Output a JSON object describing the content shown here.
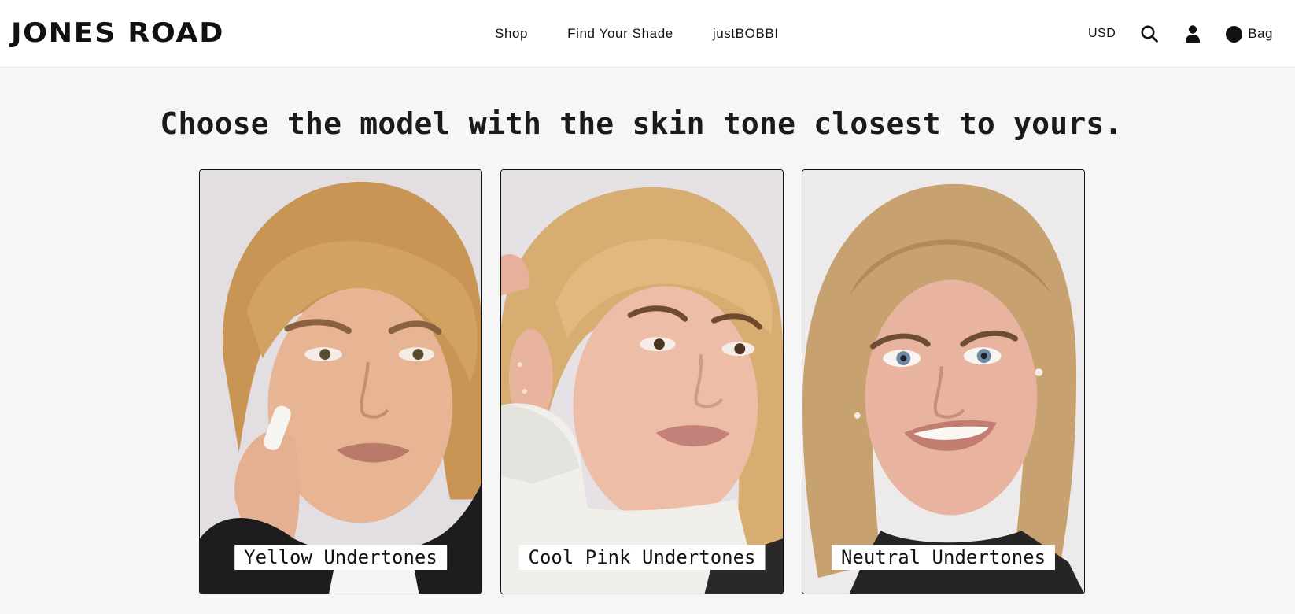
{
  "header": {
    "logo_text": "JONES ROAD",
    "nav": [
      {
        "label": "Shop"
      },
      {
        "label": "Find Your Shade"
      },
      {
        "label": "justBOBBI"
      }
    ],
    "currency": "USD",
    "search_icon": "search-icon",
    "account_icon": "account-icon",
    "bag_icon": "bag-dot-icon",
    "bag_label": "Bag"
  },
  "main": {
    "headline": "Choose the model with the skin tone closest to yours.",
    "models": [
      {
        "label": "Yellow Undertones",
        "skin": "#e7b494",
        "hair": "#c99555",
        "background": "#e3dee1",
        "clothing": "#1d1d20"
      },
      {
        "label": "Cool Pink Undertones",
        "skin": "#edbda7",
        "hair": "#d8ad72",
        "background": "#e6e1e4",
        "clothing": "#f1efe9"
      },
      {
        "label": "Neutral Undertones",
        "skin": "#e8b49f",
        "hair": "#c7a170",
        "background": "#eceaeb",
        "clothing": "#262424"
      }
    ]
  },
  "colors": {
    "page_background": "#f6f6f6",
    "header_background": "#ffffff",
    "text": "#111111"
  }
}
